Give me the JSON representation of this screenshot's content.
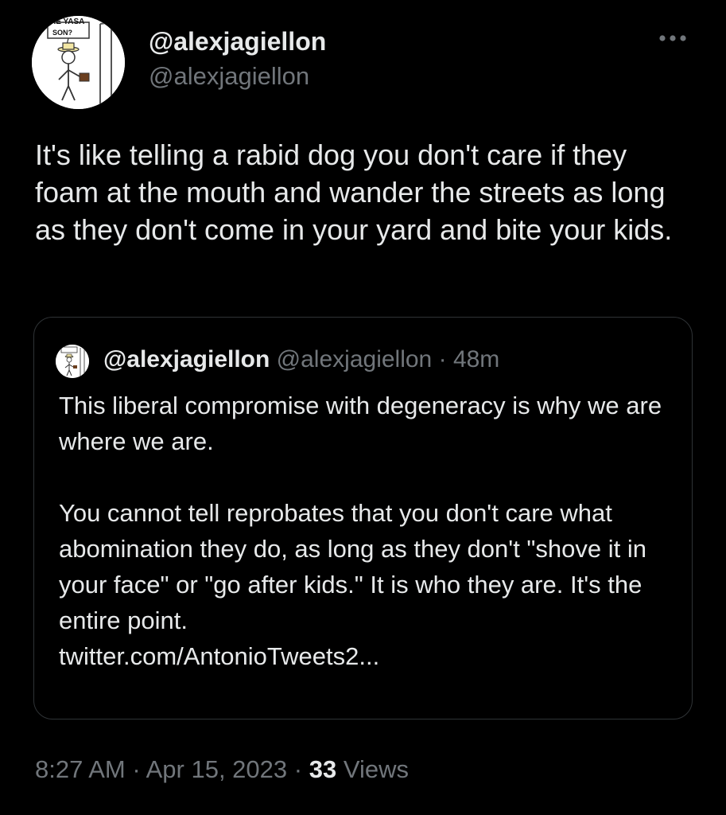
{
  "tweet": {
    "display_name": "@alexjagiellon",
    "handle": "@alexjagiellon",
    "avatar_text_top": "RE YASA",
    "avatar_text_sign": "SON?",
    "text": "It's like telling a rabid dog you don't care if they foam at the mouth and wander the streets as long as they don't come in your yard and bite your kids.",
    "time": "8:27 AM",
    "separator": "·",
    "date": "Apr 15, 2023",
    "views_count": "33",
    "views_label": "Views"
  },
  "quote": {
    "display_name": "@alexjagiellon",
    "handle": "@alexjagiellon",
    "separator": "·",
    "age": "48m",
    "paragraph1": "This liberal compromise with degeneracy is why we are where we are.",
    "paragraph2": "You cannot tell reprobates that you don't care what abomination they do, as long as they don't \"shove it in your face\" or \"go after kids.\" It is who they are. It's the entire point.",
    "link": "twitter.com/AntonioTweets2..."
  },
  "icons": {
    "more": "more-horizontal-icon",
    "avatar": "stick-figure-avatar"
  },
  "colors": {
    "background": "#000000",
    "primary_text": "#e7e9ea",
    "secondary_text": "#71767b",
    "border": "#2f3336"
  }
}
